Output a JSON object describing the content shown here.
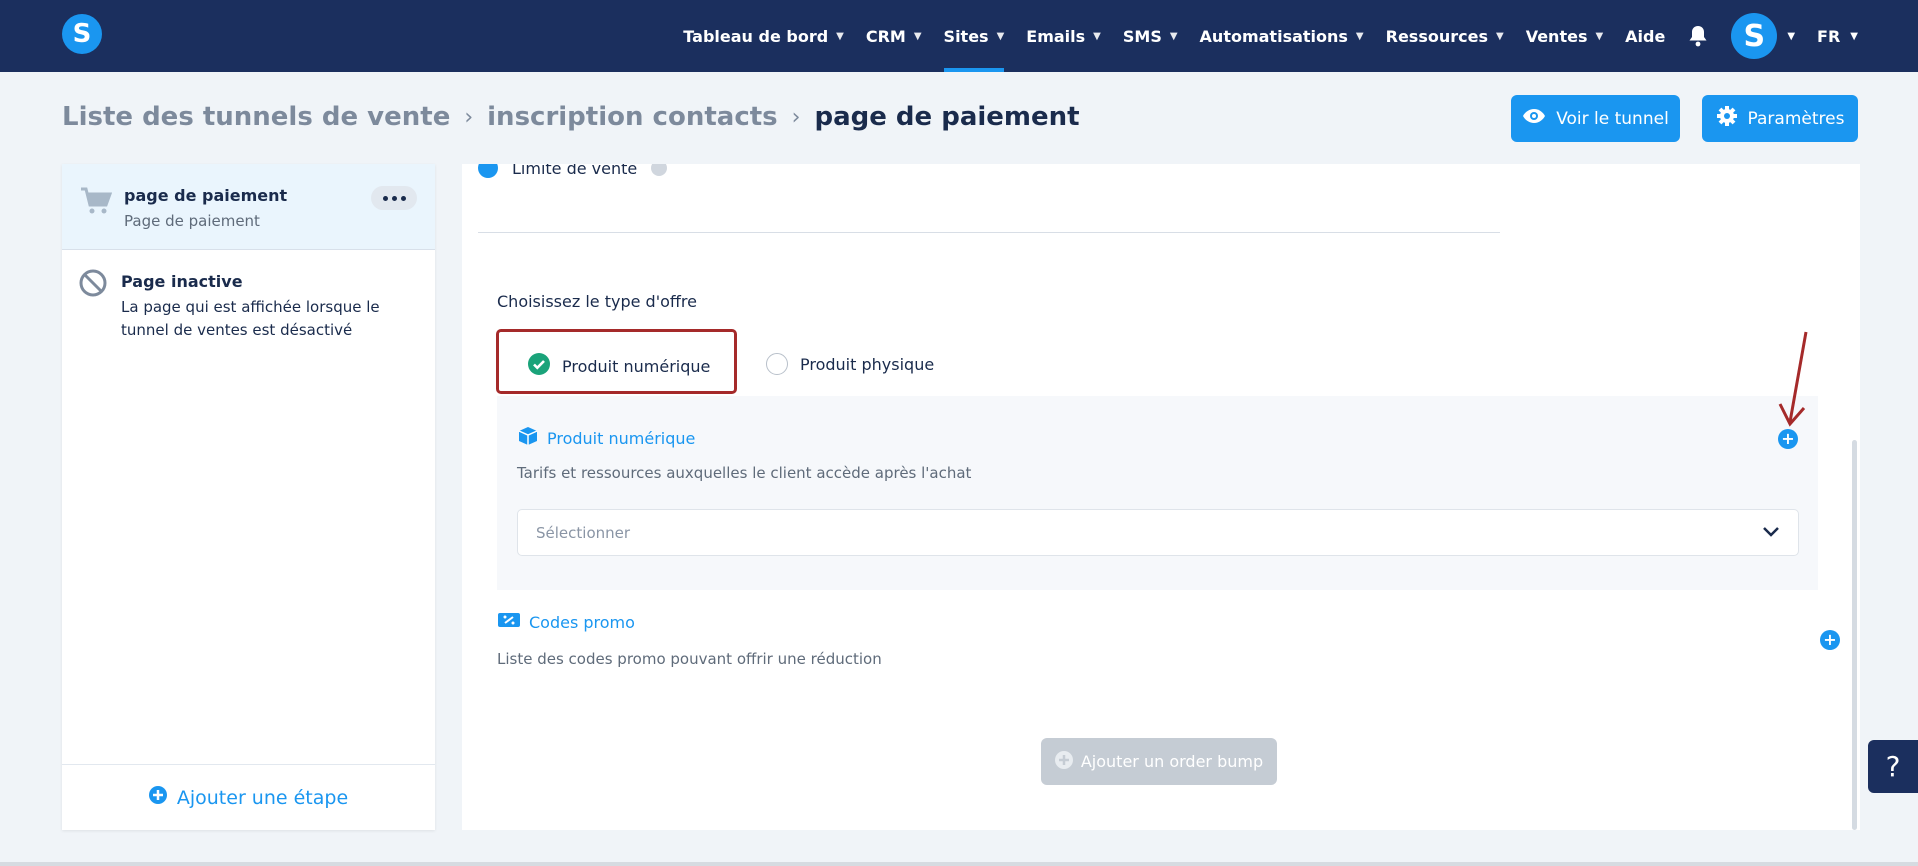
{
  "header": {
    "logo": "S",
    "nav": [
      {
        "label": "Tableau de bord",
        "has_menu": true,
        "active": false
      },
      {
        "label": "CRM",
        "has_menu": true,
        "active": false
      },
      {
        "label": "Sites",
        "has_menu": true,
        "active": true
      },
      {
        "label": "Emails",
        "has_menu": true,
        "active": false
      },
      {
        "label": "SMS",
        "has_menu": true,
        "active": false
      },
      {
        "label": "Automatisations",
        "has_menu": true,
        "active": false
      },
      {
        "label": "Ressources",
        "has_menu": true,
        "active": false
      },
      {
        "label": "Ventes",
        "has_menu": true,
        "active": false
      },
      {
        "label": "Aide",
        "has_menu": false,
        "active": false
      }
    ],
    "avatar_letter": "S",
    "language": "FR"
  },
  "breadcrumb": {
    "items": [
      "Liste des tunnels de vente",
      "inscription contacts",
      "page de paiement"
    ]
  },
  "actions": {
    "view_tunnel": "Voir le tunnel",
    "settings": "Paramètres"
  },
  "sidebar": {
    "active_step": {
      "title": "page de paiement",
      "subtitle": "Page de paiement"
    },
    "inactive_step": {
      "title": "Page inactive",
      "description": "La page qui est affichée lorsque le tunnel de ventes est désactivé"
    },
    "add_step": "Ajouter une étape"
  },
  "main": {
    "limit_label": "Limite de vente",
    "offer_type_label": "Choisissez le type d'offre",
    "options": {
      "digital": "Produit numérique",
      "physical": "Produit physique"
    },
    "selected_option": "digital",
    "product": {
      "title": "Produit numérique",
      "description": "Tarifs et ressources auxquelles le client accède après l'achat",
      "select_placeholder": "Sélectionner"
    },
    "promo": {
      "title": "Codes promo",
      "description": "Liste des codes promo pouvant offrir une réduction"
    },
    "order_bump": "Ajouter un order bump"
  },
  "help_button": "?",
  "colors": {
    "navbar": "#1b2f5e",
    "accent": "#1a96f0",
    "annotation": "#a52a2a",
    "success": "#1aa37a"
  }
}
